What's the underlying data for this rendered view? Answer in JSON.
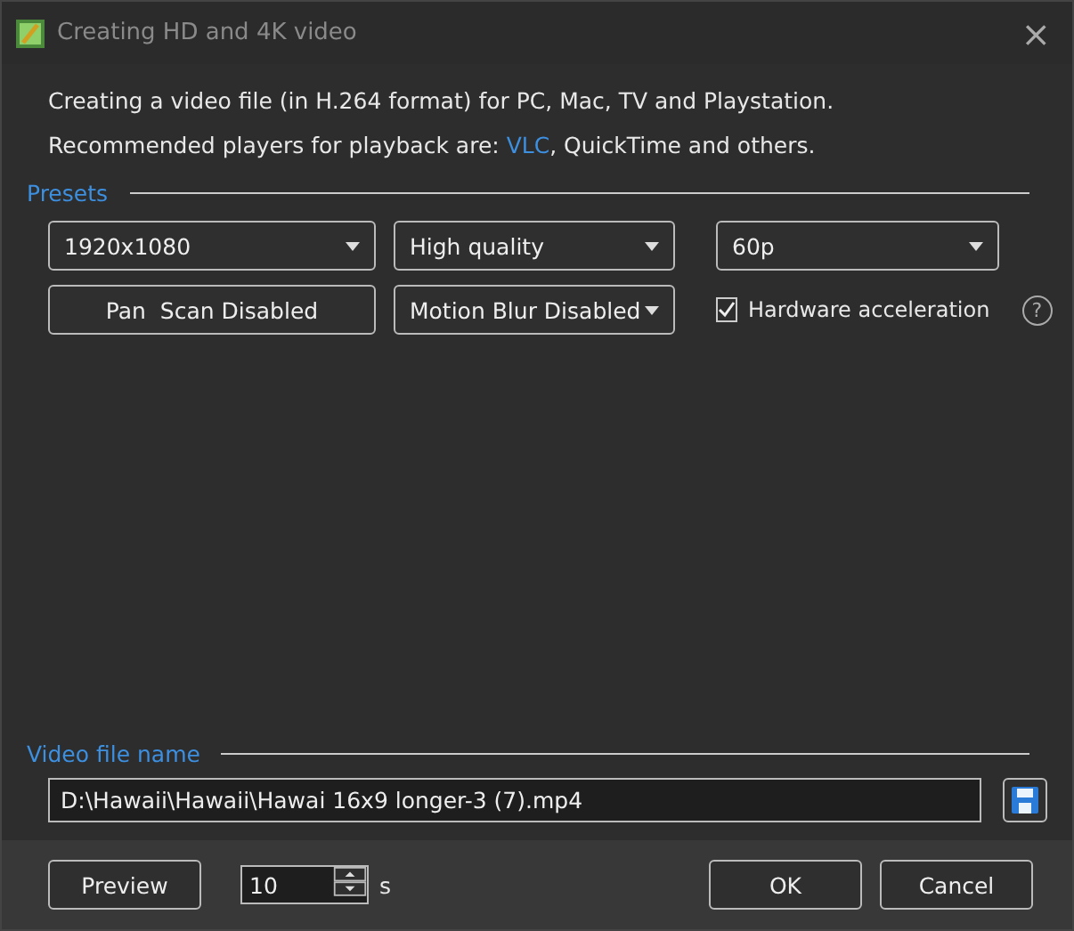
{
  "window": {
    "title": "Creating HD and 4K video",
    "close": "×"
  },
  "intro": {
    "line1": "Creating a video file (in H.264 format) for PC, Mac, TV and Playstation.",
    "line2_before": "Recommended players for playback are: ",
    "line2_link": "VLC",
    "line2_after": ", QuickTime and others."
  },
  "presets": {
    "legend": "Presets",
    "controls": [
      {
        "kind": "combo",
        "value": "1920x1080"
      },
      {
        "kind": "combo",
        "value": "High quality"
      },
      {
        "kind": "combo",
        "value": "60p"
      },
      {
        "kind": "button",
        "value": "Pan  Scan Disabled"
      },
      {
        "kind": "combo",
        "value": "Motion Blur Disabled"
      },
      {
        "kind": "checkbox",
        "value": "Hardware acceleration",
        "checked": true,
        "help": "?"
      }
    ]
  },
  "file": {
    "legend": "Video file name",
    "value": "D:\\Hawaii\\Hawaii\\Hawai 16x9 longer-3 (7).mp4"
  },
  "footer": {
    "preview": "Preview",
    "duration": "10",
    "unit": "s",
    "buttons": [
      "OK",
      "Cancel"
    ]
  }
}
